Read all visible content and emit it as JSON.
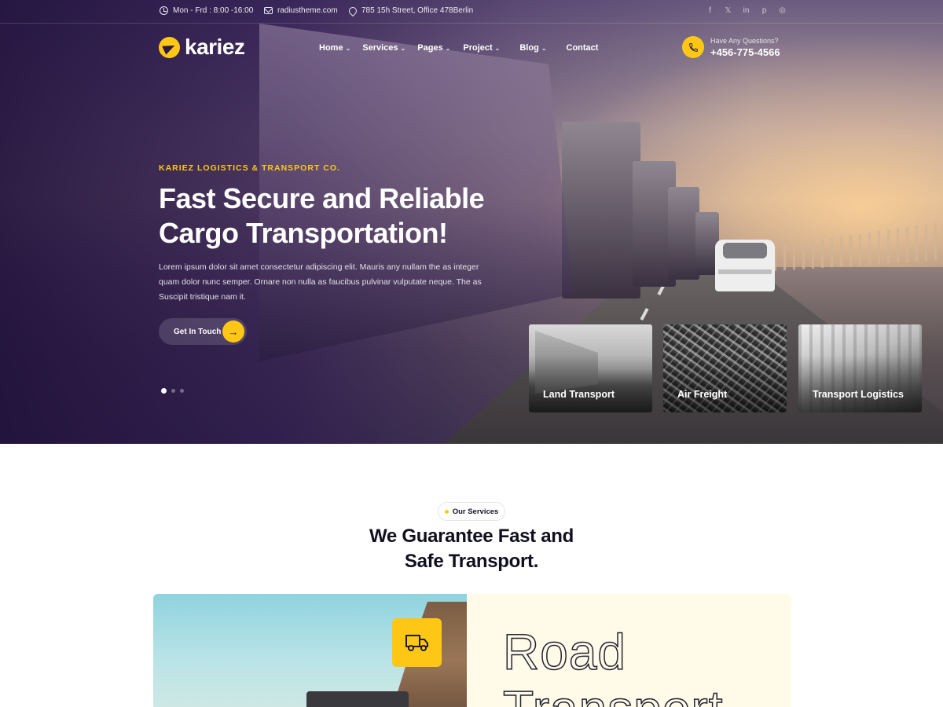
{
  "topbar": {
    "hours": "Mon - Frd : 8:00 -16:00",
    "email": "radiustheme.com",
    "address": "785 15h Street, Office 478Berlin",
    "social": [
      {
        "icon": "facebook-icon",
        "glyph": "f"
      },
      {
        "icon": "x-icon",
        "glyph": "𝕏"
      },
      {
        "icon": "linkedin-icon",
        "glyph": "in"
      },
      {
        "icon": "pinterest-icon",
        "glyph": "p"
      },
      {
        "icon": "instagram-icon",
        "glyph": "◎"
      }
    ]
  },
  "header": {
    "logo_text": "kariez",
    "nav": [
      {
        "label": "Home",
        "dropdown": true
      },
      {
        "label": "Services",
        "dropdown": true
      },
      {
        "label": "Pages",
        "dropdown": true
      },
      {
        "label": "Project",
        "dropdown": true
      },
      {
        "label": "Blog",
        "dropdown": true
      },
      {
        "label": "Contact",
        "dropdown": false
      }
    ],
    "caret": "⌄",
    "phone_question": "Have Any Questions?",
    "phone_number": "+456-775-4566"
  },
  "hero": {
    "eyebrow": "KARIEZ LOGISTICS & TRANSPORT CO.",
    "title_line1": "Fast Secure and Reliable",
    "title_line2": "Cargo Transportation!",
    "description": "Lorem ipsum dolor sit amet consectetur adipiscing elit. Mauris any nullam the as integer quam dolor nunc semper. Ornare non nulla as faucibus pulvinar vulputate neque. The as Suscipit tristique nam it.",
    "cta_label": "Get In Touch",
    "cta_arrow": "→",
    "slides_total": 3,
    "slide_active": 1,
    "cards": [
      {
        "label": "Land Transport"
      },
      {
        "label": "Air Freight"
      },
      {
        "label": "Transport Logistics"
      }
    ]
  },
  "services": {
    "badge": "Our Services",
    "title_line1": "We Guarantee Fast and",
    "title_line2": "Safe Transport.",
    "feature_title_line1": "Road",
    "feature_title_line2": "Transport",
    "feature_icon": "truck-icon"
  },
  "colors": {
    "accent": "#ffc715",
    "dark": "#2a1a44",
    "panel": "#fffbe8"
  }
}
